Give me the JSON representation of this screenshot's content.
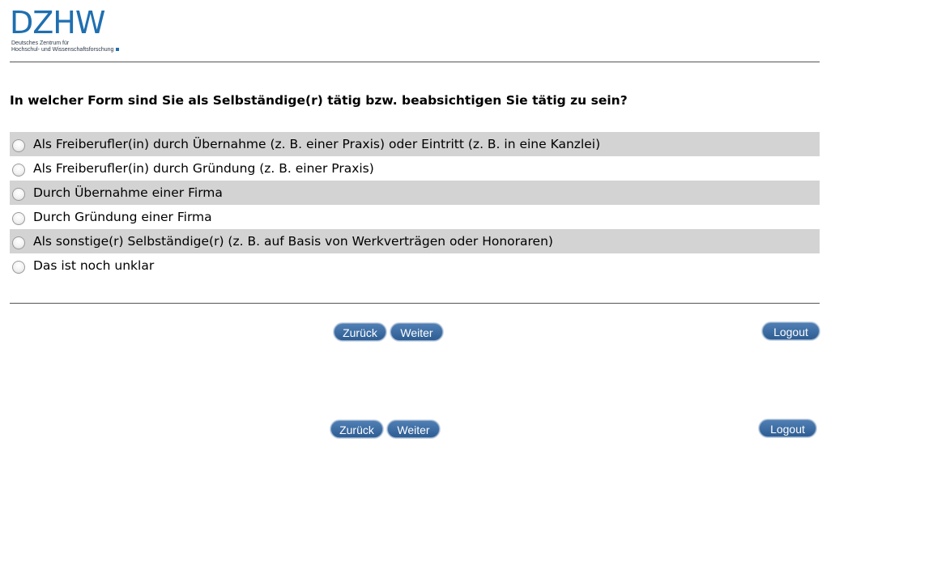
{
  "logo": {
    "mark": "DZHW",
    "subtitle_line1": "Deutsches Zentrum für",
    "subtitle_line2": "Hochschul- und Wissenschaftsforschung"
  },
  "question": {
    "text": "In welcher Form sind Sie als Selbständige(r) tätig bzw. beabsichtigen Sie tätig zu sein?"
  },
  "options": [
    {
      "label": "Als Freiberufler(in) durch Übernahme (z. B. einer Praxis) oder Eintritt (z. B. in eine Kanzlei)",
      "selected": false
    },
    {
      "label": "Als Freiberufler(in) durch Gründung (z. B. einer Praxis)",
      "selected": false
    },
    {
      "label": "Durch Übernahme einer Firma",
      "selected": false
    },
    {
      "label": "Durch Gründung einer Firma",
      "selected": false
    },
    {
      "label": "Als sonstige(r) Selbständige(r) (z. B. auf Basis von Werkverträgen oder Honoraren)",
      "selected": false
    },
    {
      "label": "Das ist noch unklar",
      "selected": false
    }
  ],
  "nav_primary": {
    "back_label": "Zurück",
    "next_label": "Weiter",
    "logout_label": "Logout"
  },
  "nav_secondary": {
    "back_label": "Zurück",
    "next_label": "Weiter",
    "logout_label": "Logout"
  },
  "colors": {
    "brand": "#1f6fb0",
    "button": "#3a6aa3",
    "row_shade": "#d3d3d3"
  }
}
